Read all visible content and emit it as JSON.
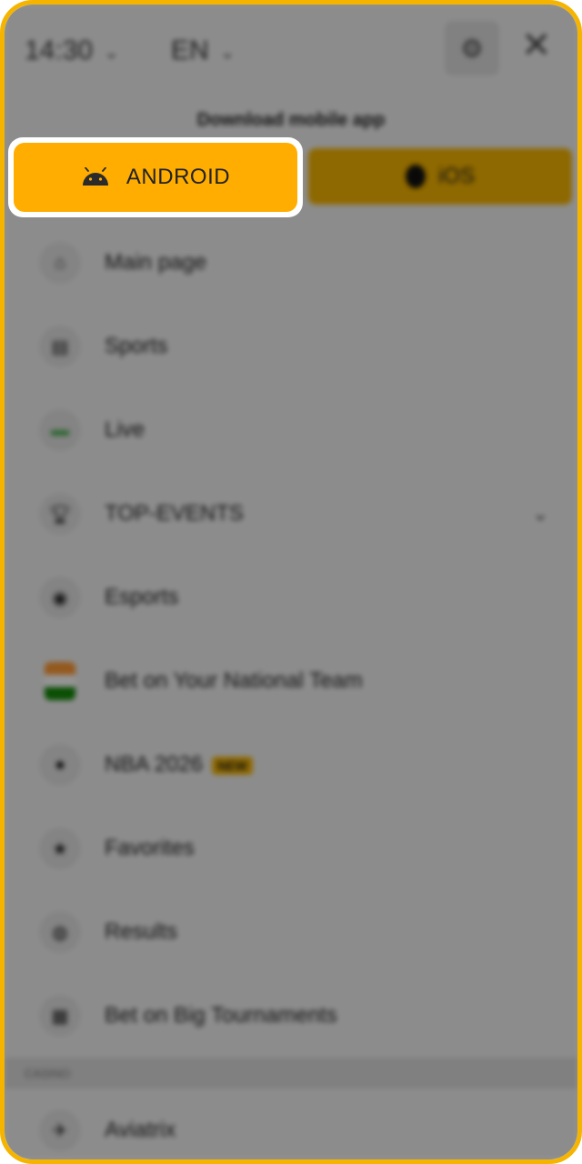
{
  "header": {
    "time": "14:30",
    "language": "EN"
  },
  "download": {
    "label": "Download mobile app",
    "android_label": "ANDROID",
    "ios_label": "iOS"
  },
  "menu": {
    "items": [
      {
        "label": "Main page",
        "icon": "home-icon"
      },
      {
        "label": "Sports",
        "icon": "sports-icon"
      },
      {
        "label": "Live",
        "icon": "live-icon"
      },
      {
        "label": "TOP-EVENTS",
        "icon": "trophy-icon"
      },
      {
        "label": "Esports",
        "icon": "gamepad-icon"
      },
      {
        "label": "Bet on Your National Team",
        "icon": "flag-icon"
      },
      {
        "label": "NBA 2026",
        "icon": "basketball-icon",
        "badge": "NEW"
      },
      {
        "label": "Favorites",
        "icon": "star-icon"
      },
      {
        "label": "Results",
        "icon": "results-icon"
      },
      {
        "label": "Bet on Big Tournaments",
        "icon": "calendar-icon"
      }
    ],
    "section_label": "CASINO",
    "bottom_item": {
      "label": "Aviatrix",
      "icon": "plane-icon"
    }
  },
  "colors": {
    "accent": "#ffad00",
    "frame": "#f5b400",
    "overlay": "rgba(0,0,0,0.42)"
  }
}
